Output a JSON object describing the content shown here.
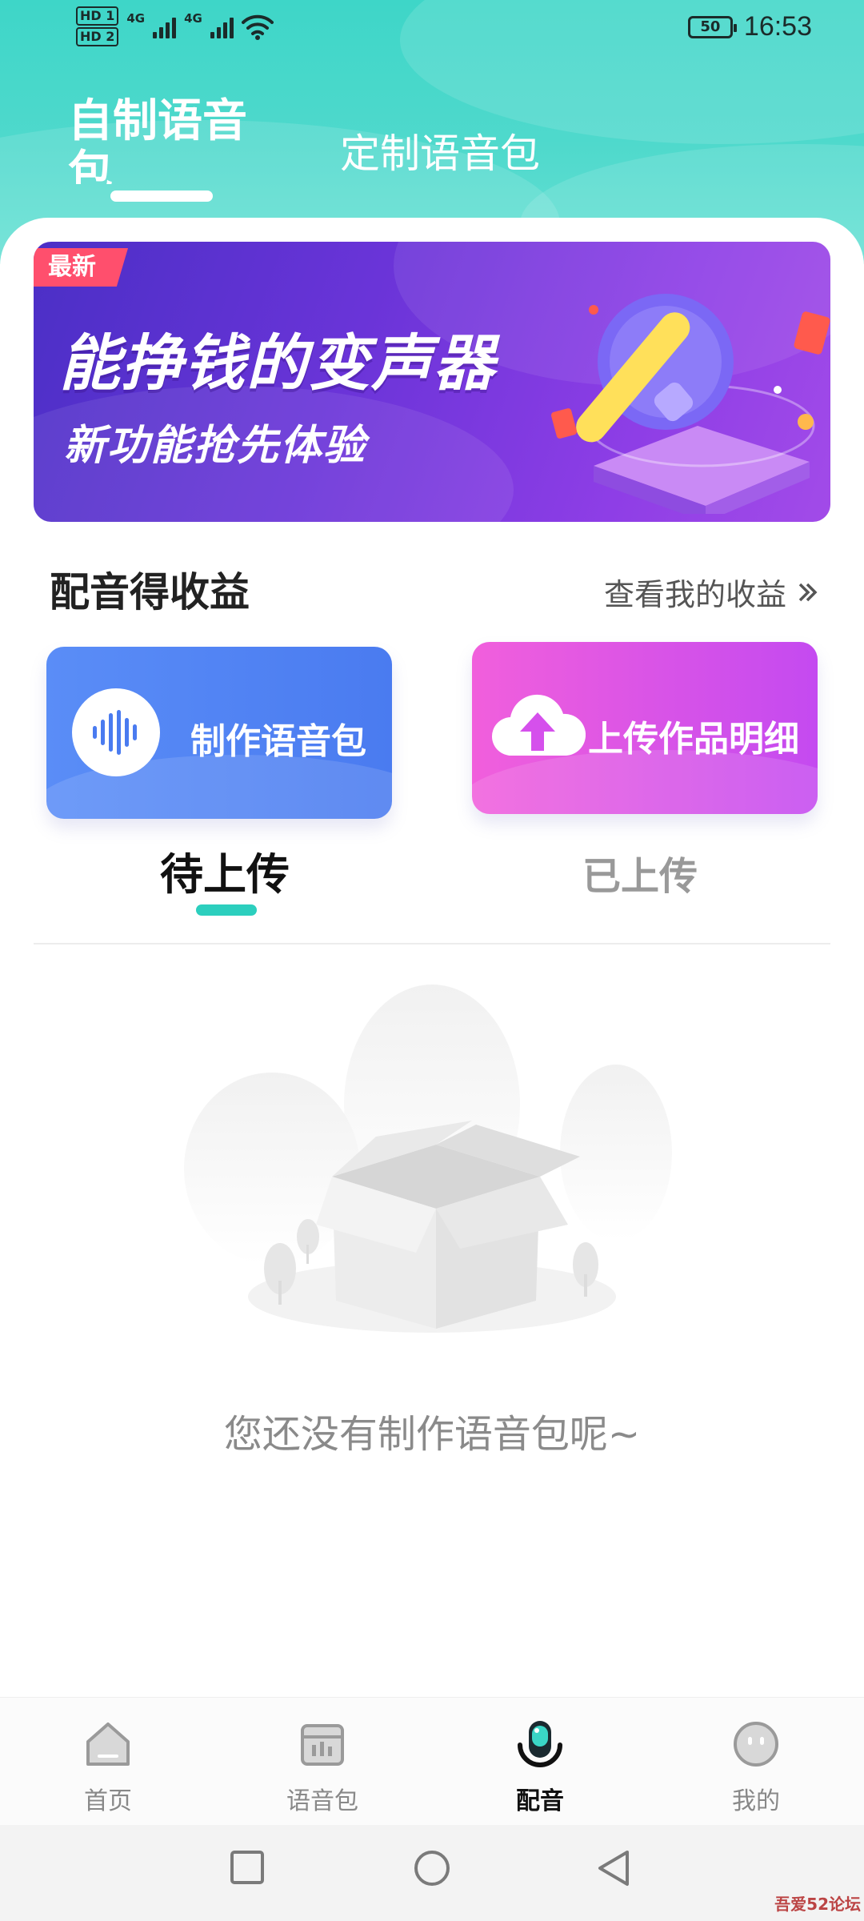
{
  "status_bar": {
    "hd1": "HD 1",
    "hd2": "HD 2",
    "net1": "4G",
    "net2": "4G",
    "battery": "50",
    "time": "16:53"
  },
  "top_tabs": [
    {
      "label": "自制语音包",
      "active": true
    },
    {
      "label": "定制语音包",
      "active": false
    }
  ],
  "banner": {
    "tag": "最新",
    "title": "能挣钱的变声器",
    "subtitle": "新功能抢先体验"
  },
  "earnings": {
    "title": "配音得收益",
    "link": "查看我的收益"
  },
  "actions": {
    "make": "制作语音包",
    "upload": "上传作品明细"
  },
  "sub_tabs": [
    {
      "label": "待上传",
      "active": true
    },
    {
      "label": "已上传",
      "active": false
    }
  ],
  "empty_state": {
    "message": "您还没有制作语音包呢~"
  },
  "bottom_nav": [
    {
      "label": "首页",
      "icon": "home-icon"
    },
    {
      "label": "语音包",
      "icon": "voice-pack-icon"
    },
    {
      "label": "配音",
      "icon": "microphone-icon",
      "active": true
    },
    {
      "label": "我的",
      "icon": "profile-icon"
    }
  ],
  "watermark": "吾爱52论坛",
  "colors": {
    "accent": "#2ccfbe",
    "header": "#3ed6c8",
    "blue_card": "#4a7bf0",
    "purple_card": "#c44af0",
    "banner": "#6a34d8"
  }
}
